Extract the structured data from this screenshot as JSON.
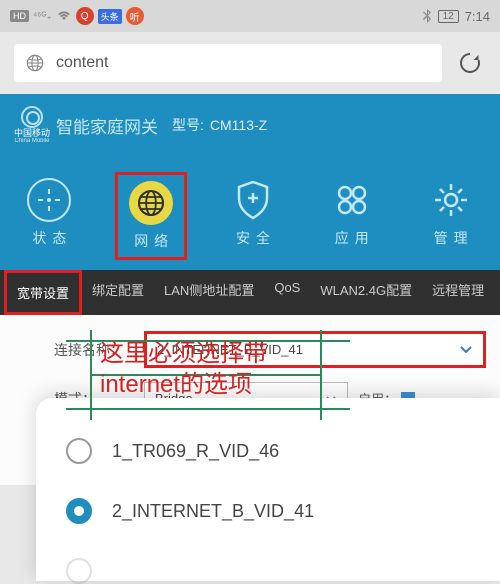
{
  "status_bar": {
    "hd": "HD",
    "sig": "⁴⁶ᴳ₊",
    "battery": "12",
    "time": "7:14"
  },
  "browser": {
    "url_text": "content"
  },
  "router": {
    "brand_cn": "中国移动",
    "brand_en": "China Mobile",
    "title": "智能家庭网关",
    "model_label": "型号:",
    "model": "CM113-Z"
  },
  "nav": [
    {
      "label": "状态"
    },
    {
      "label": "网络"
    },
    {
      "label": "安全"
    },
    {
      "label": "应用"
    },
    {
      "label": "管理"
    }
  ],
  "tabs": [
    "宽带设置",
    "绑定配置",
    "LAN侧地址配置",
    "QoS",
    "WLAN2.4G配置",
    "远程管理"
  ],
  "form": {
    "conn_label": "连接名称：",
    "conn_value": "2_INTERNET_B_VID_41",
    "mode_label": "模式：",
    "mode_value": "Bridge",
    "enable_label": "启用："
  },
  "annotation": {
    "line1": "这里必须选择带",
    "line2": "internet的选项"
  },
  "popup": {
    "opt1": "1_TR069_R_VID_46",
    "opt2": "2_INTERNET_B_VID_41"
  }
}
